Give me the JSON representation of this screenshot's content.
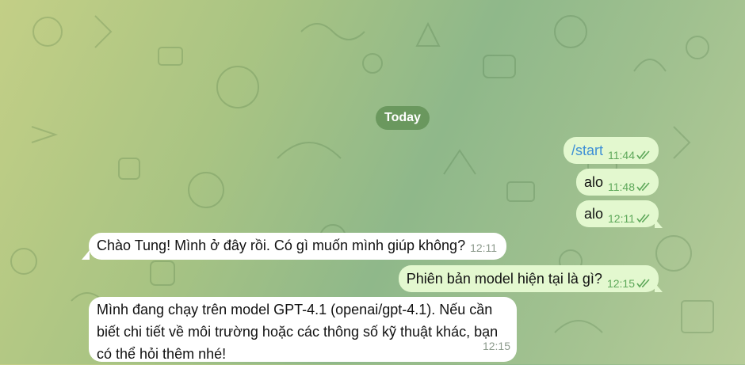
{
  "date_separator": "Today",
  "messages": [
    {
      "direction": "outgoing",
      "text": "/start",
      "time": "11:44",
      "status": "read"
    },
    {
      "direction": "outgoing",
      "text": "alo",
      "time": "11:48",
      "status": "read"
    },
    {
      "direction": "outgoing",
      "text": "alo",
      "time": "12:11",
      "status": "read"
    },
    {
      "direction": "incoming",
      "text": "Chào Tung! Mình ở đây rồi. Có gì muốn mình giúp không?",
      "time": "12:11"
    },
    {
      "direction": "outgoing",
      "text": "Phiên bản model hiện tại là gì?",
      "time": "12:15",
      "status": "read"
    },
    {
      "direction": "incoming",
      "text": "Mình đang chạy trên model GPT-4.1 (openai/gpt-4.1). Nếu cần biết chi tiết về môi trường hoặc các thông số kỹ thuật khác, bạn có thể hỏi thêm nhé!",
      "time": "12:15"
    }
  ],
  "icons": {
    "read_receipt": "double-check-icon"
  },
  "colors": {
    "outgoing_bubble": "#e3f8cf",
    "incoming_bubble": "#ffffff",
    "check": "#5ea85a",
    "command_text": "#3d8fd6"
  }
}
